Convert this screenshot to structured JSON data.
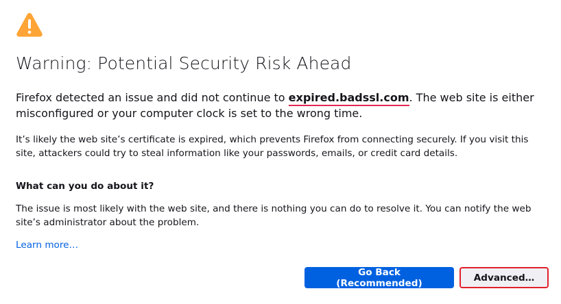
{
  "error_page": {
    "title": "Warning: Potential Security Risk Ahead",
    "intro": {
      "before": "Firefox detected an issue and did not continue to ",
      "host": "expired.badssl.com",
      "after": ". The web site is either misconfigured or your computer clock is set to the wrong time."
    },
    "detail": "It’s likely the web site’s certificate is expired, which prevents Firefox from connecting securely. If you visit this site, attackers could try to steal information like your passwords, emails, or credit card details.",
    "what_heading": "What can you do about it?",
    "what_body": "The issue is most likely with the web site, and there is nothing you can do to resolve it. You can notify the web site’s administrator about the problem.",
    "learn_more": "Learn more…",
    "go_back_label": "Go Back (Recommended)",
    "advanced_label": "Advanced…"
  },
  "icons": {
    "warning": "warning-triangle-icon"
  },
  "colors": {
    "warning_icon": "#ffa436",
    "primary_button": "#0061e0",
    "host_underline": "#e22850",
    "link": "#0061e0",
    "highlight_border": "#e0202a"
  }
}
